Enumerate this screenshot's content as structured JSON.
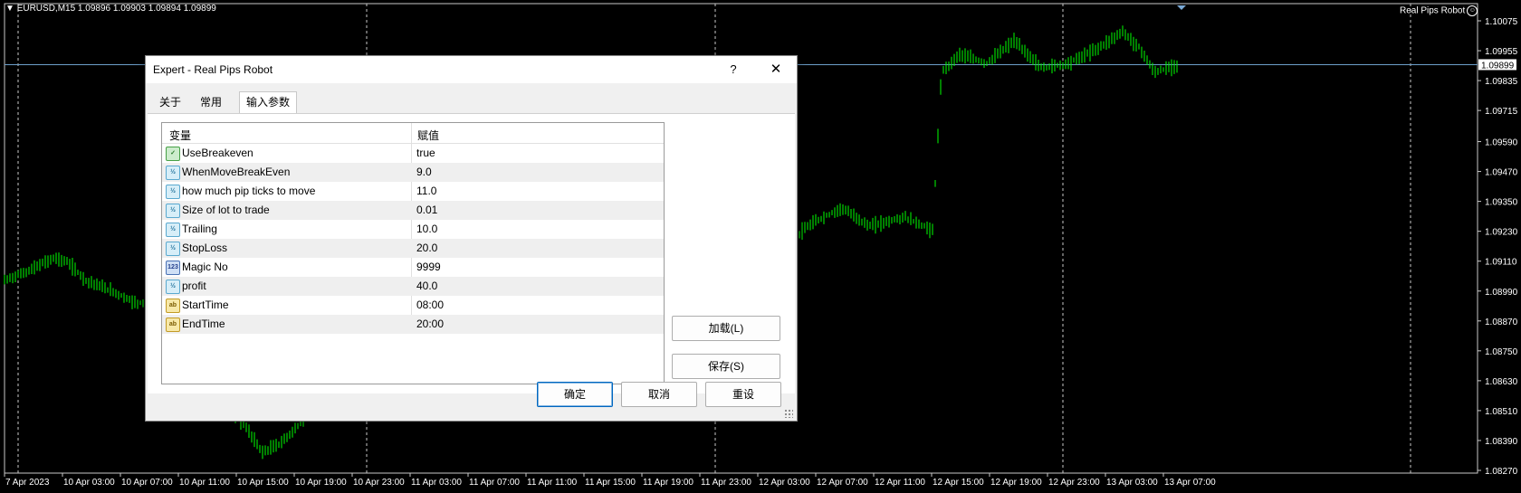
{
  "chart": {
    "symbol_line": "EURUSD,M15  1.09896 1.09903 1.09894 1.09899",
    "robot_label": "Real Pips Robot",
    "current_price": "1.09899",
    "price_labels": [
      "1.10075",
      "1.09955",
      "1.09835",
      "1.09715",
      "1.09590",
      "1.09470",
      "1.09350",
      "1.09230",
      "1.09110",
      "1.08990",
      "1.08870",
      "1.08750",
      "1.08630",
      "1.08510",
      "1.08390",
      "1.08270"
    ],
    "time_labels": [
      "7 Apr 2023",
      "10 Apr 03:00",
      "10 Apr 07:00",
      "10 Apr 11:00",
      "10 Apr 15:00",
      "10 Apr 19:00",
      "10 Apr 23:00",
      "11 Apr 03:00",
      "11 Apr 07:00",
      "11 Apr 11:00",
      "11 Apr 15:00",
      "11 Apr 19:00",
      "11 Apr 23:00",
      "12 Apr 03:00",
      "12 Apr 07:00",
      "12 Apr 11:00",
      "12 Apr 15:00",
      "12 Apr 19:00",
      "12 Apr 23:00",
      "13 Apr 03:00",
      "13 Apr 07:00"
    ],
    "colors": {
      "candles": "#00ff00",
      "background": "#000000",
      "grid": "#c8c8c8",
      "price_line": "#6c9ec9"
    }
  },
  "dialog": {
    "title": "Expert - Real Pips Robot",
    "help": "?",
    "close": "✕",
    "tabs": [
      "关于",
      "常用",
      "输入参数"
    ],
    "active_tab": 2,
    "columns": {
      "variable": "变量",
      "value": "赋值"
    },
    "params": [
      {
        "icon": "bool",
        "name": "UseBreakeven",
        "value": "true"
      },
      {
        "icon": "dbl",
        "name": "WhenMoveBreakEven",
        "value": "9.0"
      },
      {
        "icon": "dbl",
        "name": "how much pip ticks to move",
        "value": "11.0"
      },
      {
        "icon": "dbl",
        "name": "Size of lot to trade",
        "value": "0.01"
      },
      {
        "icon": "dbl",
        "name": "Trailing",
        "value": "10.0"
      },
      {
        "icon": "dbl",
        "name": "StopLoss",
        "value": "20.0"
      },
      {
        "icon": "int",
        "name": "Magic No",
        "value": "9999"
      },
      {
        "icon": "dbl",
        "name": "profit",
        "value": "40.0"
      },
      {
        "icon": "str",
        "name": "StartTime",
        "value": "08:00"
      },
      {
        "icon": "str",
        "name": "EndTime",
        "value": "20:00"
      }
    ],
    "buttons": {
      "load": "加载(L)",
      "save": "保存(S)",
      "ok": "确定",
      "cancel": "取消",
      "reset": "重设"
    }
  }
}
